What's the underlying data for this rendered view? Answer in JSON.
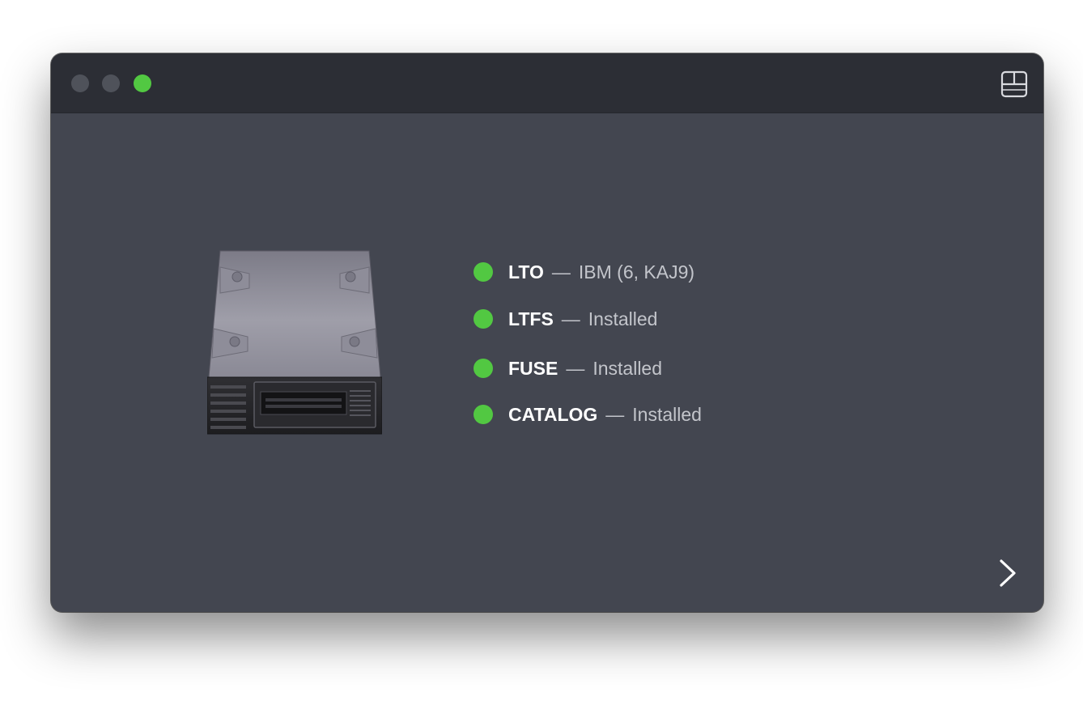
{
  "window": {
    "traffic_lights": [
      "inactive",
      "inactive",
      "active"
    ],
    "accent_color": "#52c842",
    "background_color": "#434650",
    "titlebar_color": "#2c2e35"
  },
  "icons": {
    "layout": "layout-icon",
    "drive": "tape-drive-icon",
    "next": "chevron-right-icon"
  },
  "status": {
    "separator": "—",
    "items": [
      {
        "name": "LTO",
        "value": "IBM (6, KAJ9)",
        "state_color": "#52c842"
      },
      {
        "name": "LTFS",
        "value": "Installed",
        "state_color": "#52c842"
      },
      {
        "name": "FUSE",
        "value": "Installed",
        "state_color": "#52c842"
      },
      {
        "name": "CATALOG",
        "value": "Installed",
        "state_color": "#52c842"
      }
    ]
  }
}
